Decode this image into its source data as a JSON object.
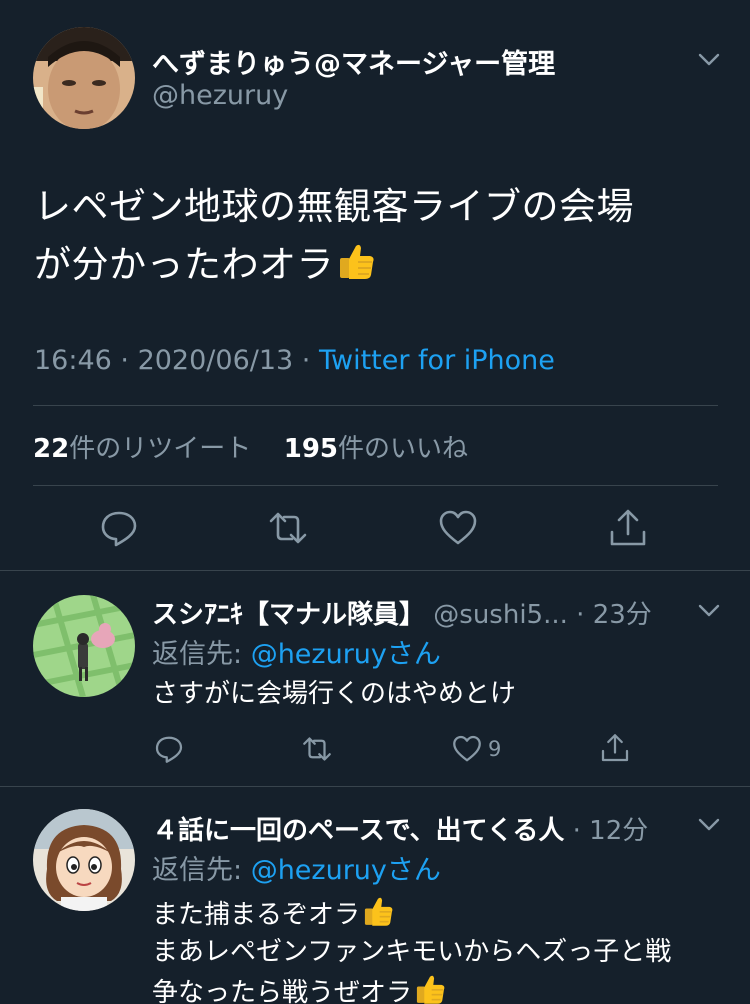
{
  "main_tweet": {
    "display_name": "へずまりゅう@マネージャー管理",
    "handle": "@hezuruy",
    "text_line1": "レペゼン地球の無観客ライブの会場",
    "text_line2": "が分かったわオラ",
    "emoji": "thumbs-up",
    "time": "16:46",
    "date": "2020/06/13",
    "source": "Twitter for iPhone",
    "retweet_count": "22",
    "retweet_label": "件のリツイート",
    "like_count": "195",
    "like_label": "件のいいね"
  },
  "replies": [
    {
      "display_name": "スシｱﾆｷ【マナル隊員】",
      "handle": "@sushi5...",
      "time": "23分",
      "replying_label": "返信先: ",
      "replying_to": "@hezuruyさん",
      "text_lines": [
        "さすがに会場行くのはやめとけ"
      ],
      "like_count": "9"
    },
    {
      "display_name": "４話に一回のペースで、出てくる人",
      "time": "12分",
      "replying_label": "返信先: ",
      "replying_to": "@hezuruyさん",
      "text_lines": [
        "また捕まるぞオラ",
        "まあレペゼンファンキモいからヘズっ子と戦",
        "争なったら戦うぜオラ"
      ]
    }
  ],
  "colors": {
    "background": "#15202b",
    "secondary_text": "#8899a6",
    "link": "#1da1f2",
    "divider": "#38444d"
  }
}
